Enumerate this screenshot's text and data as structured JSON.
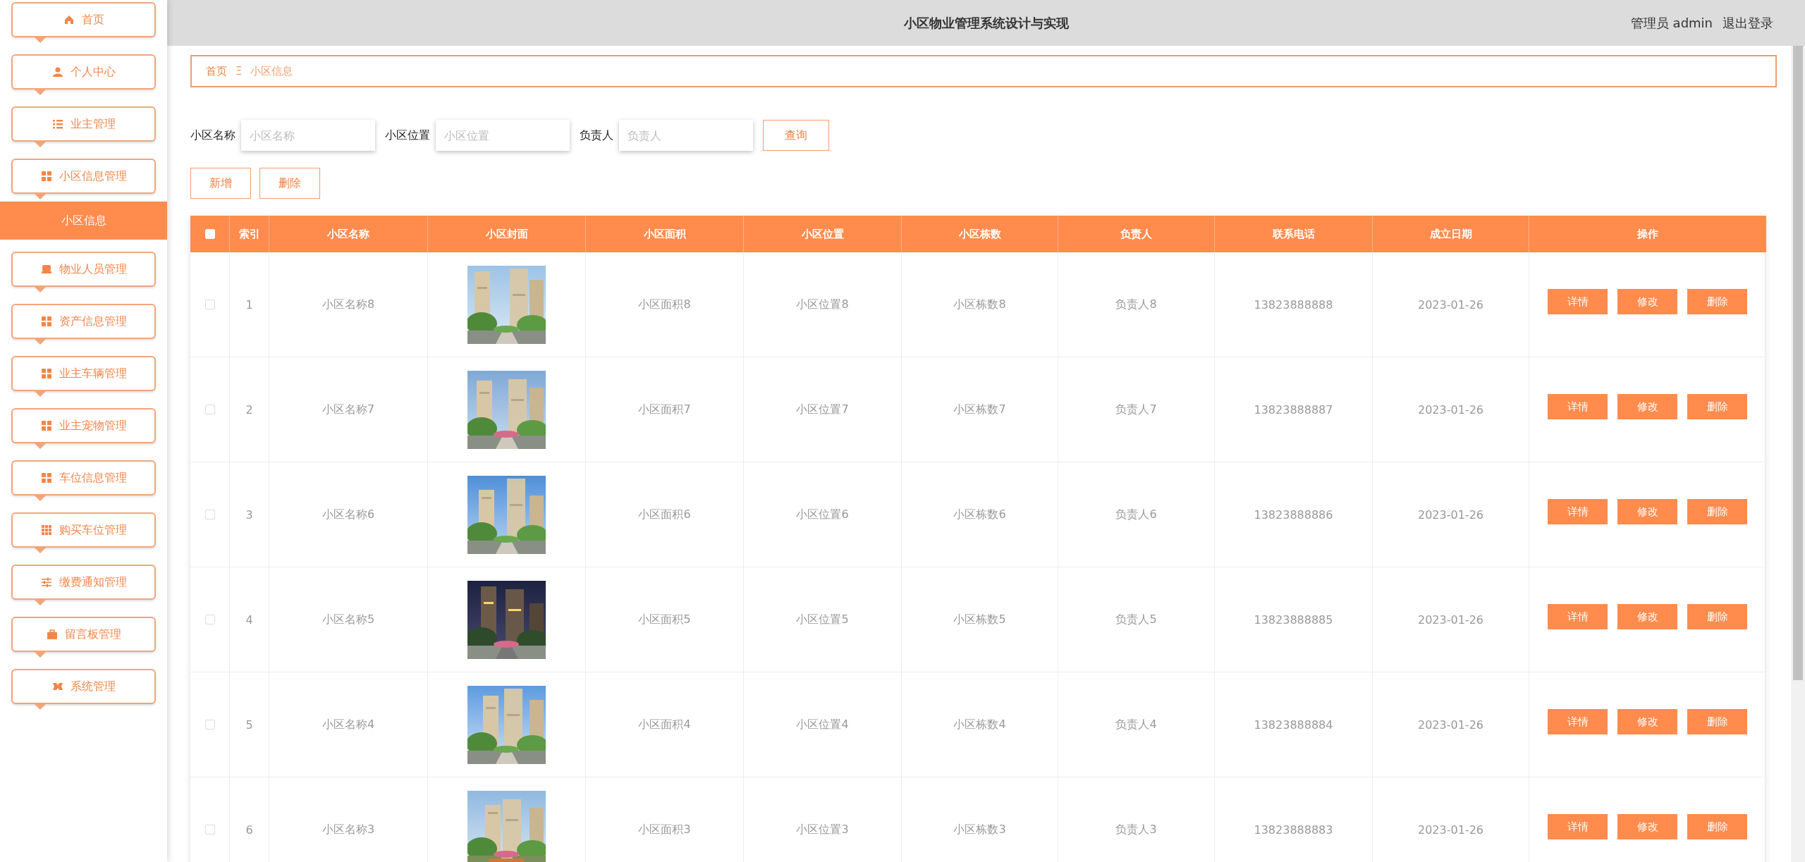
{
  "header": {
    "title": "小区物业管理系统设计与实现",
    "user": "管理员 admin",
    "logout": "退出登录"
  },
  "sidebar": {
    "items": [
      {
        "label": "首页",
        "selected": false
      },
      {
        "label": "个人中心",
        "selected": false
      },
      {
        "label": "业主管理",
        "selected": false
      },
      {
        "label": "小区信息管理",
        "selected": false,
        "expanded": true,
        "children": [
          {
            "label": "小区信息",
            "selected": true
          }
        ]
      },
      {
        "label": "物业人员管理",
        "selected": false
      },
      {
        "label": "资产信息管理",
        "selected": false
      },
      {
        "label": "业主车辆管理",
        "selected": false
      },
      {
        "label": "业主宠物管理",
        "selected": false
      },
      {
        "label": "车位信息管理",
        "selected": false
      },
      {
        "label": "购买车位管理",
        "selected": false
      },
      {
        "label": "缴费通知管理",
        "selected": false
      },
      {
        "label": "留言板管理",
        "selected": false
      },
      {
        "label": "系统管理",
        "selected": false
      }
    ]
  },
  "breadcrumb": {
    "home": "首页",
    "separator": "Ξ",
    "current": "小区信息"
  },
  "search": {
    "fields": [
      {
        "label": "小区名称",
        "placeholder": "小区名称"
      },
      {
        "label": "小区位置",
        "placeholder": "小区位置"
      },
      {
        "label": "负责人",
        "placeholder": "负责人"
      }
    ],
    "button": "查询"
  },
  "actions": [
    "新增",
    "删除"
  ],
  "table": {
    "select_all": {
      "checked": false
    },
    "columns": [
      "索引",
      "小区名称",
      "小区封面",
      "小区面积",
      "小区位置",
      "小区栋数",
      "负责人",
      "联系电话",
      "成立日期",
      "操作"
    ],
    "rows": [
      {
        "checked": false,
        "index": "1",
        "name": "小区名称8",
        "area": "小区面积8",
        "location": "小区位置8",
        "buildings": "小区栋数8",
        "manager": "负责人8",
        "phone": "13823888888",
        "date": "2023-01-26",
        "buttons": [
          "详情",
          "修改",
          "删除"
        ]
      },
      {
        "checked": false,
        "index": "2",
        "name": "小区名称7",
        "area": "小区面积7",
        "location": "小区位置7",
        "buildings": "小区栋数7",
        "manager": "负责人7",
        "phone": "13823888887",
        "date": "2023-01-26",
        "buttons": [
          "详情",
          "修改",
          "删除"
        ]
      },
      {
        "checked": false,
        "index": "3",
        "name": "小区名称6",
        "area": "小区面积6",
        "location": "小区位置6",
        "buildings": "小区栋数6",
        "manager": "负责人6",
        "phone": "13823888886",
        "date": "2023-01-26",
        "buttons": [
          "详情",
          "修改",
          "删除"
        ]
      },
      {
        "checked": false,
        "index": "4",
        "name": "小区名称5",
        "area": "小区面积5",
        "location": "小区位置5",
        "buildings": "小区栋数5",
        "manager": "负责人5",
        "phone": "13823888885",
        "date": "2023-01-26",
        "buttons": [
          "详情",
          "修改",
          "删除"
        ]
      },
      {
        "checked": false,
        "index": "5",
        "name": "小区名称4",
        "area": "小区面积4",
        "location": "小区位置4",
        "buildings": "小区栋数4",
        "manager": "负责人4",
        "phone": "13823888884",
        "date": "2023-01-26",
        "buttons": [
          "详情",
          "修改",
          "删除"
        ]
      },
      {
        "checked": false,
        "index": "6",
        "name": "小区名称3",
        "area": "小区面积3",
        "location": "小区位置3",
        "buildings": "小区栋数3",
        "manager": "负责人3",
        "phone": "13823888883",
        "date": "2023-01-26",
        "buttons": [
          "详情",
          "修改",
          "删除"
        ]
      }
    ]
  }
}
